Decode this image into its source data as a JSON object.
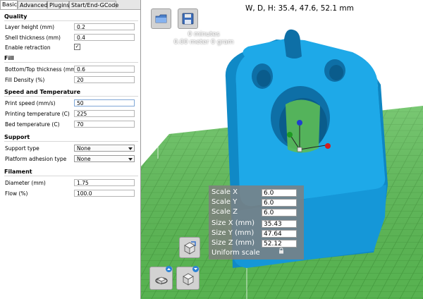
{
  "tabs": [
    "Basic",
    "Advanced",
    "Plugins",
    "Start/End-GCode"
  ],
  "sections": {
    "quality": "Quality",
    "fill": "Fill",
    "speed": "Speed and Temperature",
    "support": "Support",
    "filament": "Filament"
  },
  "fields": {
    "layer_height": {
      "label": "Layer height (mm)",
      "value": "0.2"
    },
    "shell_thickness": {
      "label": "Shell thickness (mm)",
      "value": "0.4"
    },
    "enable_retraction": {
      "label": "Enable retraction",
      "value": "✓"
    },
    "bottom_top_thickness": {
      "label": "Bottom/Top thickness (mm)",
      "value": "0.6"
    },
    "fill_density": {
      "label": "Fill Density (%)",
      "value": "20"
    },
    "print_speed": {
      "label": "Print speed (mm/s)",
      "value": "50"
    },
    "printing_temperature": {
      "label": "Printing temperature (C)",
      "value": "225"
    },
    "bed_temperature": {
      "label": "Bed temperature (C)",
      "value": "70"
    },
    "support_type": {
      "label": "Support type",
      "value": "None"
    },
    "platform_adhesion": {
      "label": "Platform adhesion type",
      "value": "None"
    },
    "diameter": {
      "label": "Diameter (mm)",
      "value": "1.75"
    },
    "flow": {
      "label": "Flow (%)",
      "value": "100.0"
    }
  },
  "viewport": {
    "dimensions": "W, D, H: 35.4, 47.6, 52.1 mm",
    "print_time": "0 minutes",
    "filament_usage": "0.00 meter 0 gram"
  },
  "scale_panel": {
    "rows": [
      {
        "label": "Scale X",
        "value": "6.0"
      },
      {
        "label": "Scale Y",
        "value": "6.0"
      },
      {
        "label": "Scale Z",
        "value": "6.0"
      },
      {
        "label": "Size X (mm)",
        "value": "35.43"
      },
      {
        "label": "Size Y (mm)",
        "value": "47.64"
      },
      {
        "label": "Size Z (mm)",
        "value": "52.12"
      }
    ],
    "uniform_label": "Uniform scale"
  },
  "icons": {
    "load": "folder-icon",
    "save": "save-disk-icon",
    "scale": "scale-cube-icon",
    "rotate": "rotate-icon",
    "view_mode": "view-mode-cube-icon",
    "lock": "lock-icon"
  },
  "colors": {
    "model": "#1ea9e8",
    "model_dark": "#1089c6",
    "bed": "#5cbc55",
    "bed_grid": "#4aa242",
    "axis_x": "#d31e1e",
    "axis_y": "#1e9a22",
    "axis_z": "#1e3fcf"
  }
}
